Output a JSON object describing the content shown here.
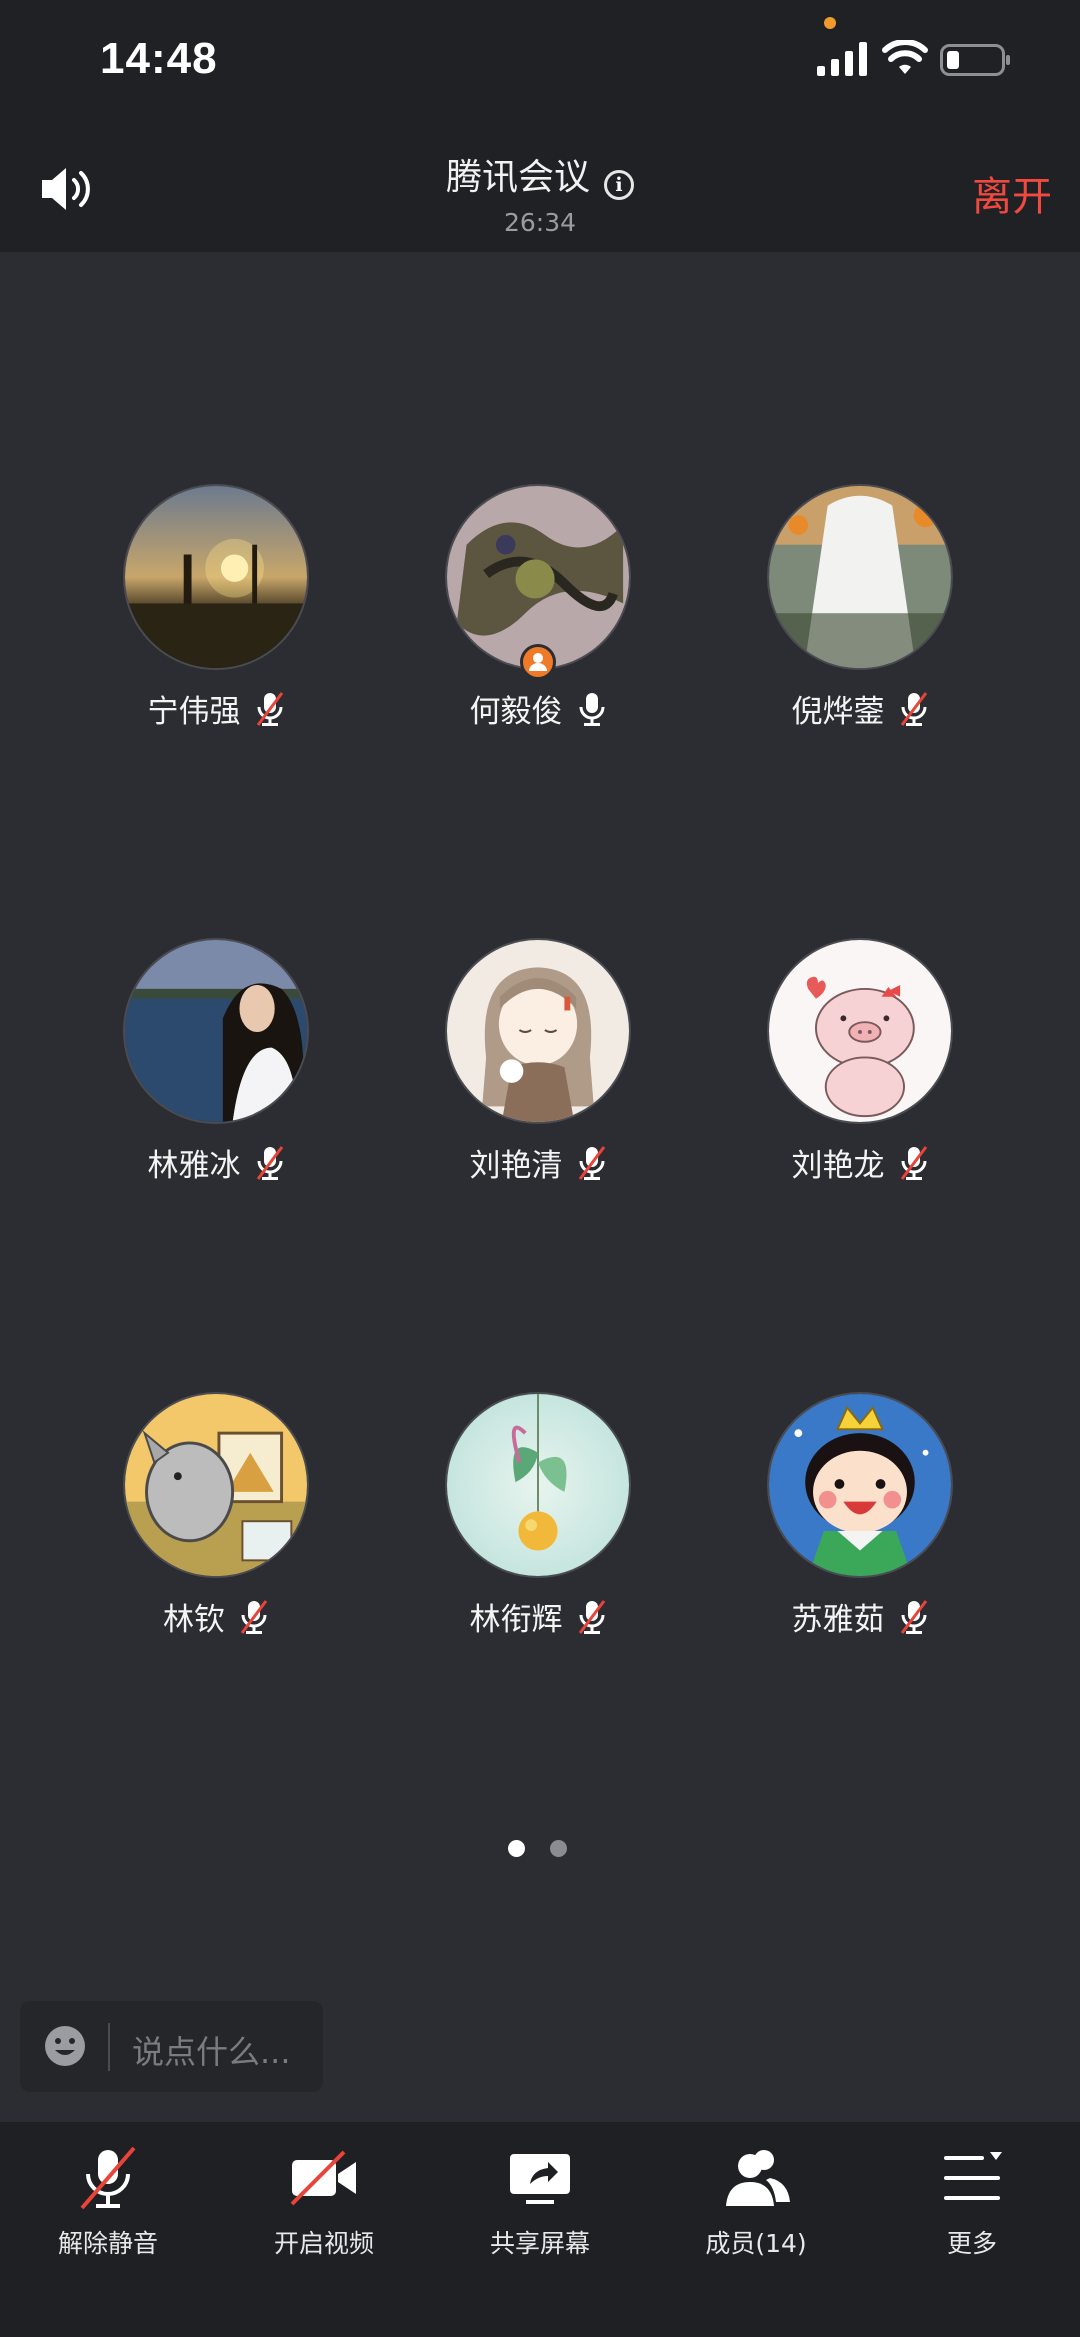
{
  "status_bar": {
    "time": "14:48",
    "icons": [
      "cellular-signal-icon",
      "wifi-icon",
      "battery-icon"
    ],
    "battery_level": 0.2,
    "indicator_color": "#f29a2e"
  },
  "header": {
    "title": "腾讯会议",
    "duration": "26:34",
    "leave_label": "离开",
    "leave_color": "#f0493f",
    "icons": [
      "speaker-icon",
      "info-icon"
    ]
  },
  "participants": [
    {
      "name": "宁伟强",
      "mic": "muted",
      "avatar": "sunset-photo"
    },
    {
      "name": "何毅俊",
      "mic": "on",
      "avatar": "ink-art",
      "host": true
    },
    {
      "name": "倪烨蓥",
      "mic": "muted",
      "avatar": "veil-photo"
    },
    {
      "name": "林雅冰",
      "mic": "muted",
      "avatar": "lake-portrait"
    },
    {
      "name": "刘艳清",
      "mic": "muted",
      "avatar": "cartoon-girl"
    },
    {
      "name": "刘艳龙",
      "mic": "muted",
      "avatar": "cartoon-pig"
    },
    {
      "name": "林钦",
      "mic": "muted",
      "avatar": "rhino-painter"
    },
    {
      "name": "林衔辉",
      "mic": "muted",
      "avatar": "lemon-plant"
    },
    {
      "name": "苏雅茹",
      "mic": "muted",
      "avatar": "cartoon-prince"
    }
  ],
  "pagination": {
    "current": 1,
    "total": 2
  },
  "chat": {
    "placeholder": "说点什么..."
  },
  "toolbar": {
    "items": [
      {
        "label": "解除静音",
        "icon": "mic-muted-icon"
      },
      {
        "label": "开启视频",
        "icon": "video-off-icon"
      },
      {
        "label": "共享屏幕",
        "icon": "share-screen-icon"
      },
      {
        "label": "成员(14)",
        "icon": "members-icon"
      },
      {
        "label": "更多",
        "icon": "more-icon"
      }
    ]
  }
}
